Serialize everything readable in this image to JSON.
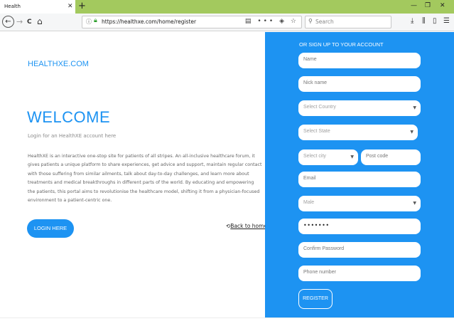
{
  "browser": {
    "tab_title": "Health",
    "tab_close": "✕",
    "new_tab": "+",
    "minimize": "—",
    "restore": "❐",
    "close": "✕",
    "back": "←",
    "forward": "→",
    "reload": "C",
    "home": "⌂",
    "url": "https://healthxe.com/home/register",
    "search_placeholder": "Search",
    "url_more": "•••"
  },
  "left": {
    "brand": "HEALTHXE.COM",
    "welcome": "WELCOME",
    "login_sub": "Login for an HealthXE account here",
    "intro": "HealthXE is an interactive one-stop site for patients of all stripes. An all-inclusive healthcare forum, it gives patients a unique platform to share experiences, get advice and support, maintain regular contact with those suffering from similar ailments, talk about day-to-day challenges, and learn more about treatments and medical breakthroughs in different parts of the world. By educating and empowering the patients, this portal aims to revolutionise the healthcare model, shifting it from a physician-focused environment to a patient-centric one.",
    "login_button": "LOGIN HERE",
    "back_home": "Back to home"
  },
  "form": {
    "title": "OR SIGN UP TO YOUR ACCOUNT",
    "name": "Name",
    "nick_name": "Nick name",
    "country": "Select Country",
    "state": "Select State",
    "city": "Select city",
    "post_code": "Post code",
    "email": "Email",
    "gender": "Male",
    "password_mask": "•••••••",
    "confirm_password": "Confirm Password",
    "phone": "Phone number",
    "register_button": "REGISTER"
  },
  "colors": {
    "accent": "#1d93f2",
    "tab_bar": "#a3c95e"
  }
}
